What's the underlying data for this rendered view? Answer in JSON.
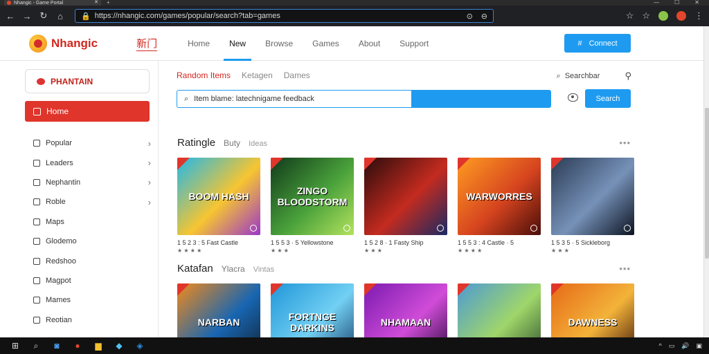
{
  "browser": {
    "tab_title": "Nhangic - Game Portal",
    "address": "https://nhangic.com/games/popular/search?tab=games",
    "window_controls": [
      "—",
      "☐",
      "✕"
    ]
  },
  "header": {
    "logo_text": "Nhangic",
    "badge": "新门",
    "nav": [
      {
        "label": "Home",
        "active": false
      },
      {
        "label": "New",
        "active": true
      },
      {
        "label": "Browse",
        "active": false
      },
      {
        "label": "Games",
        "active": false
      },
      {
        "label": "About",
        "active": false
      },
      {
        "label": "Support",
        "active": false
      }
    ],
    "cta_label": "Connect"
  },
  "sidebar": {
    "profile_label": "PHANTAIN",
    "home_label": "Home",
    "items": [
      {
        "label": "Popular",
        "chevron": true,
        "icon": "file-icon"
      },
      {
        "label": "Leaders",
        "chevron": true,
        "icon": "grid-icon"
      },
      {
        "label": "Nephantin",
        "chevron": true,
        "icon": "mail-icon"
      },
      {
        "label": "Roble",
        "chevron": true,
        "icon": "book-icon"
      },
      {
        "label": "Maps",
        "chevron": false,
        "icon": "map-icon"
      },
      {
        "label": "Glodemo",
        "chevron": false,
        "icon": "star-icon"
      },
      {
        "label": "Redshoo",
        "chevron": false,
        "icon": "chat-icon"
      },
      {
        "label": "Magpot",
        "chevron": false,
        "icon": "cart-icon"
      },
      {
        "label": "Mames",
        "chevron": false,
        "icon": "folder-icon"
      },
      {
        "label": "Reotian",
        "chevron": false,
        "icon": "person-icon"
      }
    ]
  },
  "main": {
    "subtabs": [
      {
        "label": "Random Items",
        "active": true
      },
      {
        "label": "Ketagen",
        "active": false
      },
      {
        "label": "Dames",
        "active": false
      }
    ],
    "search_link": "Searchbar",
    "search_query": "Item blame: latechnigame feedback",
    "search_button": "Search",
    "sections": [
      {
        "title": "Ratingle",
        "subtitle": "Buty",
        "more": "Ideas",
        "cards": [
          {
            "art": "BOOM HASH",
            "caption": "1 5 2 3 : 5 Fast Castle",
            "meta": "★ ★ ★ ★",
            "colors": [
              "#22b8e8",
              "#f7c531",
              "#9a37c9"
            ]
          },
          {
            "art": "ZINGO BLOODSTORM",
            "caption": "1 5 5 3 · 5 Yellowstone",
            "meta": "★ ★ ★",
            "colors": [
              "#113a1b",
              "#4aa23b",
              "#b3e25e"
            ]
          },
          {
            "art": "",
            "caption": "1 5 2 8 · 1 Fasty Ship",
            "meta": "★ ★ ★",
            "colors": [
              "#2b0c0c",
              "#c42b1f",
              "#1a2a63"
            ]
          },
          {
            "art": "WARWORRES",
            "caption": "1 5 5 3 : 4 Castle · 5",
            "meta": "★ ★ ★ ★",
            "colors": [
              "#ff9c22",
              "#d6441f",
              "#4a0e0a"
            ]
          },
          {
            "art": "",
            "caption": "1 5 3 5 · 5 Sickleborg",
            "meta": "★ ★ ★",
            "colors": [
              "#2b3c55",
              "#7691b8",
              "#0c1320"
            ]
          }
        ]
      },
      {
        "title": "Katafan",
        "subtitle": "Ylacra",
        "more": "Vintas",
        "cards": [
          {
            "art": "NARBAN",
            "colors": [
              "#f28a1a",
              "#1866b2",
              "#123"
            ]
          },
          {
            "art": "FORTNGE DARKINS",
            "colors": [
              "#2196d8",
              "#72d0f3",
              "#173a66"
            ]
          },
          {
            "art": "NHAMAAN",
            "colors": [
              "#7b1bb0",
              "#d04cd8",
              "#2a0a3a"
            ]
          },
          {
            "art": "",
            "colors": [
              "#4d9ad4",
              "#9fd66a",
              "#2c4f2b"
            ]
          },
          {
            "art": "DAWNESS",
            "colors": [
              "#e66a17",
              "#f3b33a",
              "#3b1308"
            ]
          }
        ]
      }
    ]
  },
  "taskbar": {
    "icons": [
      "windows-start-icon",
      "search-icon",
      "camera-icon",
      "browser-icon",
      "folder-icon",
      "store-icon",
      "edge-icon"
    ],
    "tray": [
      "^",
      "▭",
      "🔊",
      "▣"
    ]
  },
  "colors": {
    "accent": "#1e9bf0",
    "brand": "#d0271e"
  }
}
